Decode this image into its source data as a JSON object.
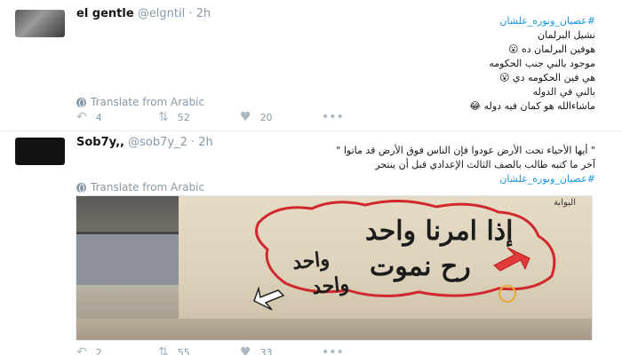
{
  "tweets": [
    {
      "name": "el gentle",
      "handle": "@elgntil",
      "separator": "·",
      "time": "2h",
      "lines": [
        "#عصيان_ونوره_علشان",
        "نشيل البرلمان",
        "هوفين البرلمان ده",
        "موجود بالني جنب الحكومه",
        "هي فين الحكومه دي",
        "بالني في الدوله",
        "ماشاءالله هو كمان فيه دوله"
      ],
      "emojis": [
        "😮",
        "😮",
        "😂"
      ],
      "translate": "Translate from Arabic",
      "replies": "4",
      "retweets": "52",
      "likes": "20"
    },
    {
      "name": "Sob7y,,",
      "handle": "@sob7y_2",
      "separator": "·",
      "time": "2h",
      "lines": [
        "\" أيها الأحياء تحت الأرض عودوا فإن الناس فوق الأرض قد ماتوا \"",
        "آخر ما كتبه طالب بالصف الثالث الإعدادي قبل أن ينتحر",
        "#عصيان_ونوره_علشان"
      ],
      "translate": "Translate from Arabic",
      "replies": "2",
      "retweets": "55",
      "likes": "33",
      "image": {
        "graffiti_line1": "إذا امرنا واحد",
        "graffiti_line2": "رح نموت",
        "graffiti_line3": "واحد",
        "graffiti_line4": "واحد",
        "watermark": "البوابة"
      }
    }
  ],
  "icons": {
    "reply": "reply-icon",
    "retweet": "retweet-icon",
    "like": "heart-icon",
    "more": "more-icon",
    "globe": "globe-icon"
  },
  "colors": {
    "accent": "#1b95e0",
    "muted": "#8899a6",
    "text": "#14171a"
  }
}
